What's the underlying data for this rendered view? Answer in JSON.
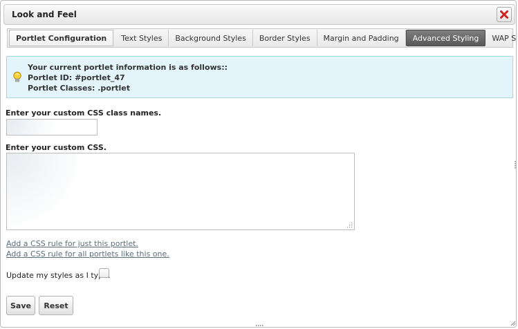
{
  "dialog": {
    "title": "Look and Feel"
  },
  "tabs": [
    {
      "label": "Portlet Configuration",
      "state": "bold"
    },
    {
      "label": "Text Styles",
      "state": ""
    },
    {
      "label": "Background Styles",
      "state": ""
    },
    {
      "label": "Border Styles",
      "state": ""
    },
    {
      "label": "Margin and Padding",
      "state": ""
    },
    {
      "label": "Advanced Styling",
      "state": "active"
    },
    {
      "label": "WAP Styling",
      "state": ""
    }
  ],
  "info": {
    "heading": "Your current portlet information is as follows::",
    "portlet_id": "Portlet ID: #portlet_47",
    "portlet_classes": "Portlet Classes: .portlet"
  },
  "form": {
    "class_names_label": "Enter your custom CSS class names.",
    "class_names_value": "",
    "css_label": "Enter your custom CSS.",
    "css_value": "",
    "link_this_portlet": "Add a CSS rule for just this portlet.",
    "link_all_portlets": "Add a CSS rule for all portlets like this one.",
    "update_label": "Update my styles as I type.",
    "update_checked": false
  },
  "buttons": {
    "save": "Save",
    "reset": "Reset"
  },
  "colors": {
    "active_tab": "#666666",
    "info_bg": "#e3f4fb",
    "info_border": "#a9d7e7",
    "close_red": "#cc2222",
    "link": "#5a6d7c"
  },
  "icons": {
    "close": "close-icon",
    "info": "lightbulb-icon",
    "resize": "resize-grip-icon"
  }
}
